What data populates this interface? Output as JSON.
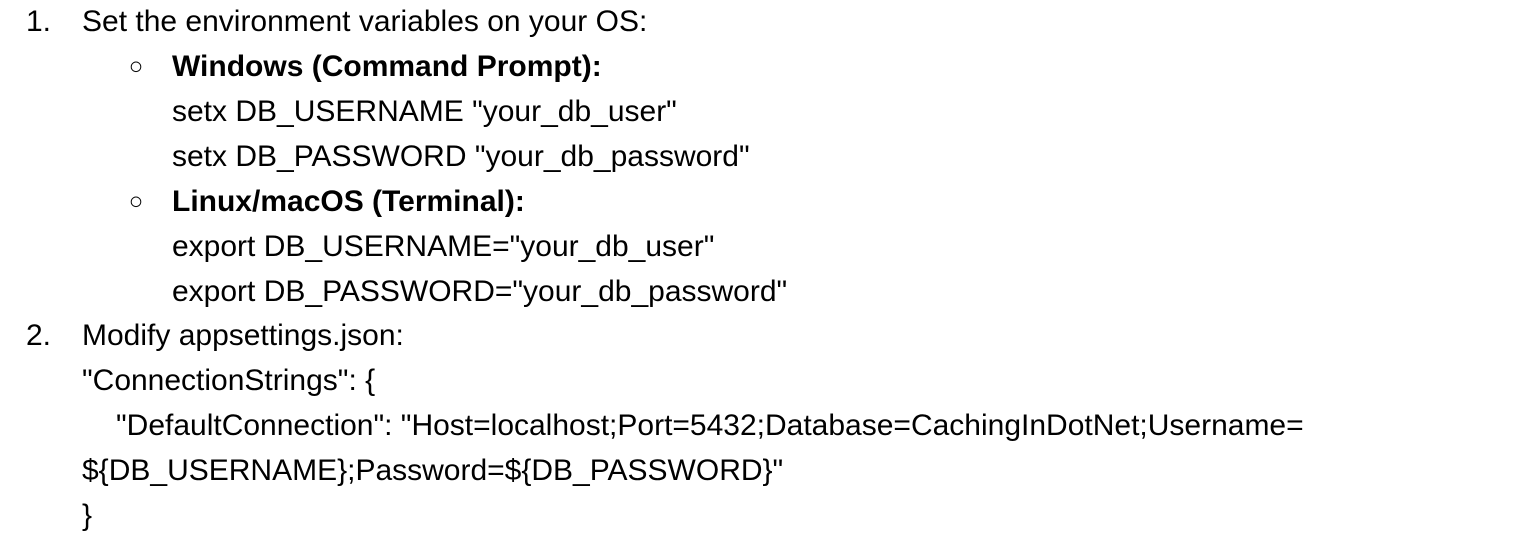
{
  "document": {
    "steps": [
      {
        "number": "1.",
        "text": "Set the environment variables on your OS:",
        "subitems": [
          {
            "bullet": "○",
            "heading": "Windows (Command Prompt):",
            "lines": [
              "setx DB_USERNAME \"your_db_user\"",
              "setx DB_PASSWORD \"your_db_password\""
            ]
          },
          {
            "bullet": "○",
            "heading": "Linux/macOS (Terminal):",
            "lines": [
              "export DB_USERNAME=\"your_db_user\"",
              "export DB_PASSWORD=\"your_db_password\""
            ]
          }
        ]
      },
      {
        "number": "2.",
        "text": "Modify appsettings.json:",
        "code_lines": [
          "\"ConnectionStrings\": {",
          "  \"DefaultConnection\": \"Host=localhost;Port=5432;Database=CachingInDotNet;Username=",
          "${DB_USERNAME};Password=${DB_PASSWORD}\"",
          "}"
        ]
      }
    ]
  }
}
